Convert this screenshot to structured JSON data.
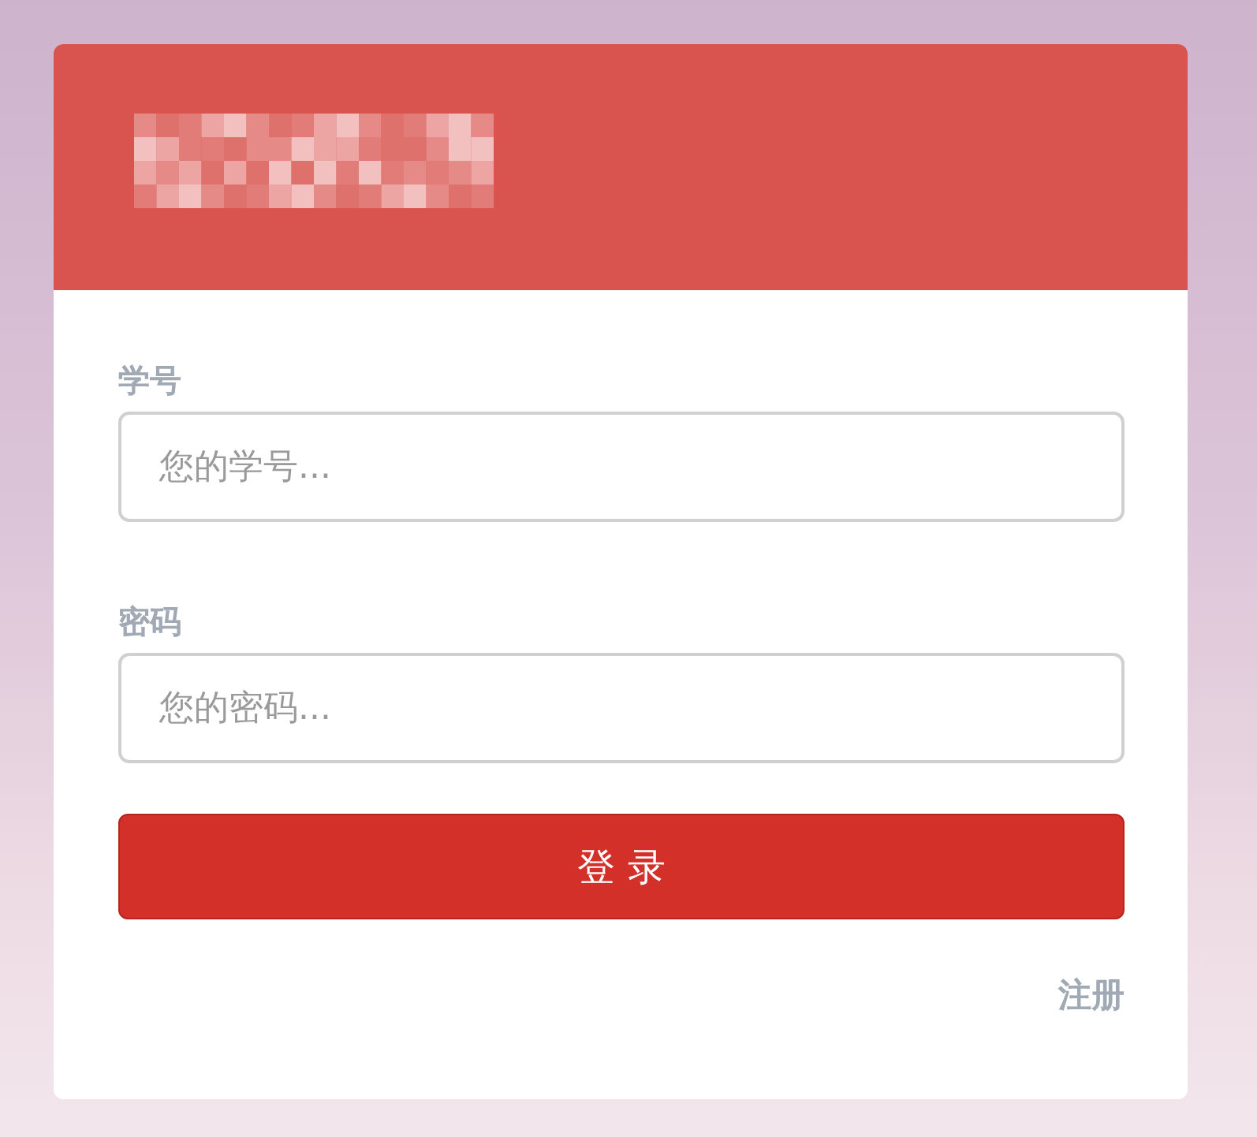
{
  "fields": [
    {
      "label": "学号",
      "placeholder": "您的学号..."
    },
    {
      "label": "密码",
      "placeholder": "您的密码..."
    }
  ],
  "button": "登 录",
  "link": "注册"
}
